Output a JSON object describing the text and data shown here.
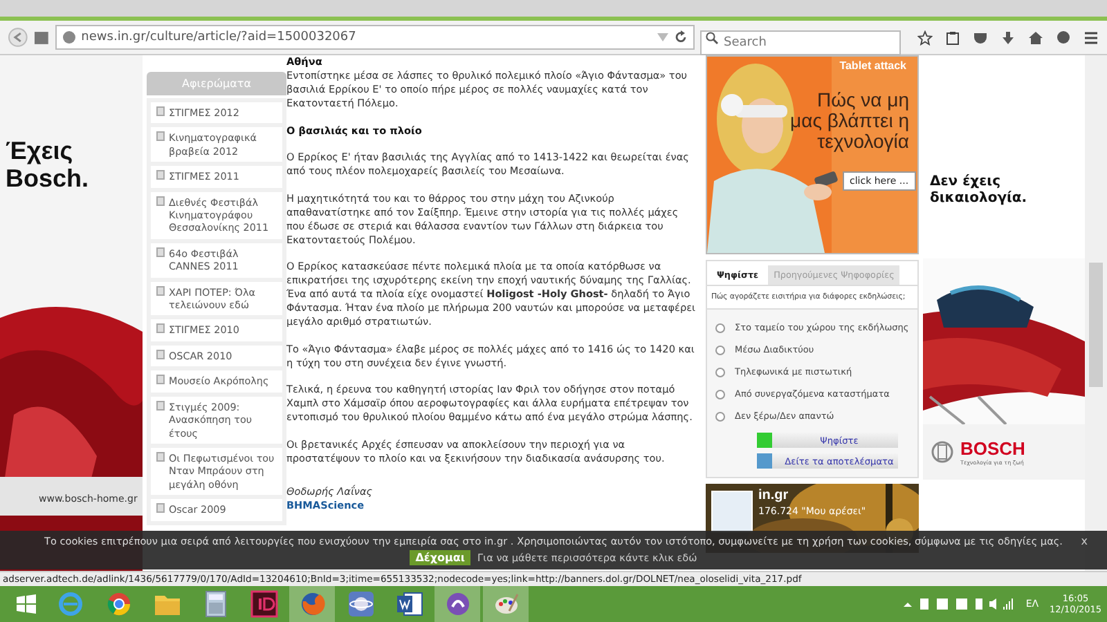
{
  "browser": {
    "url": "news.in.gr/culture/article/?aid=1500032067",
    "search": {
      "placeholder": "Search"
    }
  },
  "left_ad": {
    "headline": "Έχεις Bosch.",
    "url": "www.bosch-home.gr"
  },
  "sidebar": {
    "title": "Αφιερώματα",
    "items": [
      {
        "label": "ΣΤΙΓΜΕΣ 2012"
      },
      {
        "label": "Κινηματογραφικά βραβεία 2012"
      },
      {
        "label": "ΣΤΙΓΜΕΣ 2011"
      },
      {
        "label": "Διεθνές Φεστιβάλ Κινηματογράφου Θεσσαλονίκης 2011"
      },
      {
        "label": "64ο Φεστιβάλ CANNES 2011"
      },
      {
        "label": "ΧΑΡΙ ΠΟΤΕΡ: Όλα τελειώνουν εδώ"
      },
      {
        "label": "ΣΤΙΓΜΕΣ 2010"
      },
      {
        "label": "OSCAR 2010"
      },
      {
        "label": "Μουσείο Ακρόπολης"
      },
      {
        "label": "Στιγμές 2009: Ανασκόπηση του έτους"
      },
      {
        "label": "Οι Πεφωτισμένοι του Νταν Μπράουν στη μεγάλη οθόνη"
      },
      {
        "label": "Oscar 2009"
      }
    ]
  },
  "article": {
    "paragraphs": [
      {
        "kind": "heading",
        "text": "Αθήνα"
      },
      {
        "kind": "text",
        "text": "Εντοπίστηκε μέσα σε λάσπες το θρυλικό πολεμικό πλοίο «Άγιο Φάντασμα» του βασιλιά Ερρίκου Ε' το οποίο πήρε μέρος σε πολλές ναυμαχίες κατά τον Εκατονταετή Πόλεμο."
      },
      {
        "kind": "heading",
        "text": "Ο βασιλιάς και το πλοίο"
      },
      {
        "kind": "text",
        "text": "Ο Ερρίκος Ε' ήταν βασιλιάς της Αγγλίας από το 1413-1422 και θεωρείται ένας από τους πλέον πολεμοχαρείς βασιλείς του Μεσαίωνα."
      },
      {
        "kind": "text",
        "text": "Η μαχητικότητά του και το θάρρος του στην μάχη του Αζινκούρ απαθανατίστηκε από τον Σαίξπηρ. Έμεινε στην ιστορία για τις πολλές μάχες που έδωσε σε στεριά και θάλασσα εναντίον των Γάλλων στη διάρκεια του Εκατονταετούς Πολέμου."
      },
      {
        "kind": "text",
        "text": "Ο Ερρίκος κατασκεύασε πέντε πολεμικά πλοία με τα οποία κατόρθωσε να επικρατήσει της ισχυρότερης εκείνη την εποχή ναυτικής δύναμης της Γαλλίας. Ένα από αυτά τα πλοία είχε ονομαστεί **Holigost -Holy Ghost-** δηλαδή το Άγιο Φάντασμα. Ήταν ένα πλοίο με πλήρωμα 200 ναυτών και μπορούσε να μεταφέρει μεγάλο αριθμό στρατιωτών."
      },
      {
        "kind": "text",
        "text": "Το «Άγιο Φάντασμα» έλαβε μέρος σε πολλές μάχες από το 1416 ώς το 1420 και η τύχη του στη συνέχεια δεν έγινε γνωστή."
      },
      {
        "kind": "text",
        "text": "Τελικά, η έρευνα του καθηγητή ιστορίας Ιαν Φριλ τον οδήγησε στον ποταμό Χαμπλ στο Χάμσαϊρ όπου αεροφωτογραφίες και άλλα ευρήματα επέτρεψαν τον εντοπισμό του θρυλικού πλοίου θαμμένο κάτω από ένα μεγάλο στρώμα λάσπης."
      },
      {
        "kind": "text",
        "text": "Οι βρετανικές Αρχές έσπευσαν να αποκλείσουν την περιοχή για να προστατέψουν το πλοίο και να ξεκινήσουν την διαδικασία ανάσυρσης του."
      }
    ],
    "author": "Θοδωρής Λαΐνας",
    "source": "BHMAScience"
  },
  "banner": {
    "tag": "Tablet attack",
    "headline": "Πώς να μη μας βλάπτει η τεχνολογία",
    "button": "click here ..."
  },
  "poll": {
    "tabs": [
      {
        "label": "Ψηφίστε",
        "selected": true
      },
      {
        "label": "Προηγούμενες Ψηφοφορίες",
        "selected": false
      }
    ],
    "question": "Πώς αγοράζετε εισιτήρια για διάφορες εκδηλώσεις;",
    "options": [
      {
        "label": "Στο ταμείο του χώρου της εκδήλωσης",
        "selected": false
      },
      {
        "label": "Μέσω Διαδικτύου",
        "selected": false
      },
      {
        "label": "Τηλεφωνικά με πιστωτική",
        "selected": false
      },
      {
        "label": "Από συνεργαζόμενα καταστήματα",
        "selected": false
      },
      {
        "label": "Δεν ξέρω/Δεν απαντώ",
        "selected": false
      }
    ],
    "vote_button": "Ψηφίστε",
    "results_button": "Δείτε τα αποτελέσματα"
  },
  "social": {
    "name": "in.gr",
    "likes": "176.724 \"Μου αρέσει\""
  },
  "right_ad": {
    "headline": "Δεν έχεις δικαιολογία.",
    "brand": "BOSCH",
    "slogan": "Τεχνολογία για τη ζωή"
  },
  "cookie_bar": {
    "message": "Το cookies επιτρέπουν μια σειρά από λειτουργίες που ενισχύουν την εμπειρία σας στο in.gr . Χρησιμοποιώντας αυτόν τον ιστότοπο, συμφωνείτε με τη χρήση των cookies, σύμφωνα με τις οδηγίες μας.",
    "accept": "Δέχομαι",
    "more": "Για να μάθετε περισσότερα κάντε κλικ εδώ",
    "close": "x"
  },
  "status_bar": "adserver.adtech.de/adlink/1436/5617779/0/170/AdId=13204610;BnId=3;itime=655133532;nodecode=yes;link=http://banners.dol.gr/DOLNET/nea_oloselidi_vita_217.pdf",
  "taskbar": {
    "apps": [
      {
        "kind": "ie",
        "selected": false
      },
      {
        "kind": "chrome",
        "selected": false
      },
      {
        "kind": "folder",
        "selected": false
      },
      {
        "kind": "calculator",
        "selected": false
      },
      {
        "kind": "indesign",
        "selected": false
      },
      {
        "kind": "firefox",
        "selected": true
      },
      {
        "kind": "planet",
        "selected": false
      },
      {
        "kind": "word",
        "selected": false
      },
      {
        "kind": "torrent",
        "selected": true
      },
      {
        "kind": "paint",
        "selected": true
      }
    ],
    "language": "ΕΛ",
    "time": "16:05",
    "date": "12/10/2015"
  }
}
